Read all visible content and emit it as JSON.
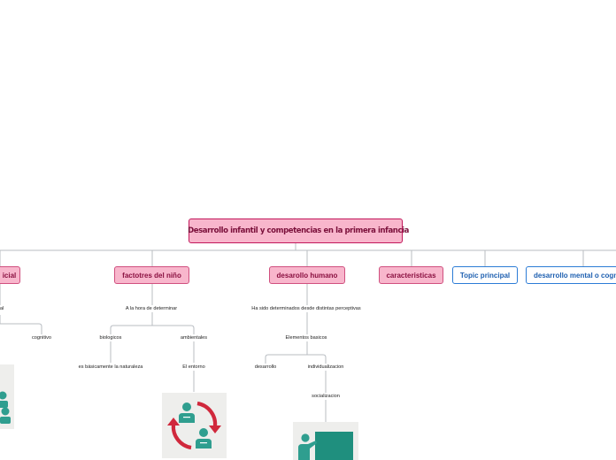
{
  "root": {
    "title": "Desarrollo infantil y competencias en la primera infancia",
    "icons": [
      "check-circle-icon",
      "sunglasses-emoji-icon"
    ]
  },
  "topics": [
    {
      "label": "icial"
    },
    {
      "label": "factotres del niño"
    },
    {
      "label": "desarollo humano"
    },
    {
      "label": "caracteristicas"
    },
    {
      "label": "Topic principal"
    },
    {
      "label": "desarrollo mental o cognitivo"
    }
  ],
  "subtopics": {
    "left": [
      "al",
      "cognitivo"
    ],
    "factores": [
      "A la hora de determinar",
      "biologicos",
      "ambientales",
      "es básicamente la naturaleza",
      "El entorno"
    ],
    "desarrollo": [
      "Ha sido determinados desde distintas perceptivas",
      "Elementos basicos",
      "desarrollo",
      "individualizacion",
      "socializacion"
    ]
  },
  "colors": {
    "pink_fill": "#f8b6cc",
    "pink_border": "#c2185b",
    "blue_border": "#2c7cd6",
    "line": "#b8bcc2",
    "icon_green": "#2f9e8f",
    "icon_red": "#d0283c"
  }
}
